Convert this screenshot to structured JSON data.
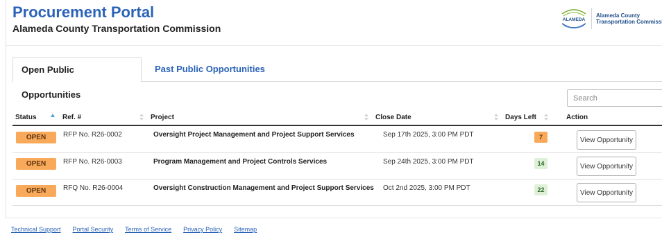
{
  "header": {
    "title": "Procurement Portal",
    "organization": "Alameda County Transportation Commission"
  },
  "logo": {
    "mark_text": "ALAMEDA",
    "line1": "Alameda County",
    "line2": "Transportation Commission"
  },
  "tabs": [
    {
      "label": "Open Public Opportunities",
      "active": true
    },
    {
      "label": "Past Public Opportunities",
      "active": false
    }
  ],
  "search": {
    "placeholder": "Search",
    "value": ""
  },
  "table": {
    "columns": [
      "Status",
      "Ref. #",
      "Project",
      "Close Date",
      "Days Left",
      "Action"
    ],
    "rows": [
      {
        "status": "OPEN",
        "ref": "RFP No. R26-0002",
        "project": "Oversight Project Management and Project Support Services",
        "close_date": "Sep 17th 2025, 3:00 PM PDT",
        "days_left": "7",
        "action": "View Opportunity"
      },
      {
        "status": "OPEN",
        "ref": "RFP No. R26-0003",
        "project": "Program Management and Project Controls Services",
        "close_date": "Sep 24th 2025, 3:00 PM PDT",
        "days_left": "14",
        "action": "View Opportunity"
      },
      {
        "status": "OPEN",
        "ref": "RFQ No. R26-0004",
        "project": "Oversight Construction Management and Project Support Services",
        "close_date": "Oct 2nd 2025, 3:00 PM PDT",
        "days_left": "22",
        "action": "View Opportunity"
      }
    ]
  },
  "footer": {
    "links": [
      "Technical Support",
      "Portal Security",
      "Terms of Service",
      "Privacy Policy",
      "Sitemap"
    ]
  },
  "colors": {
    "brand_blue": "#2b63b8",
    "status_orange": "#f9a95a",
    "days_green_bg": "#dff0d8"
  }
}
